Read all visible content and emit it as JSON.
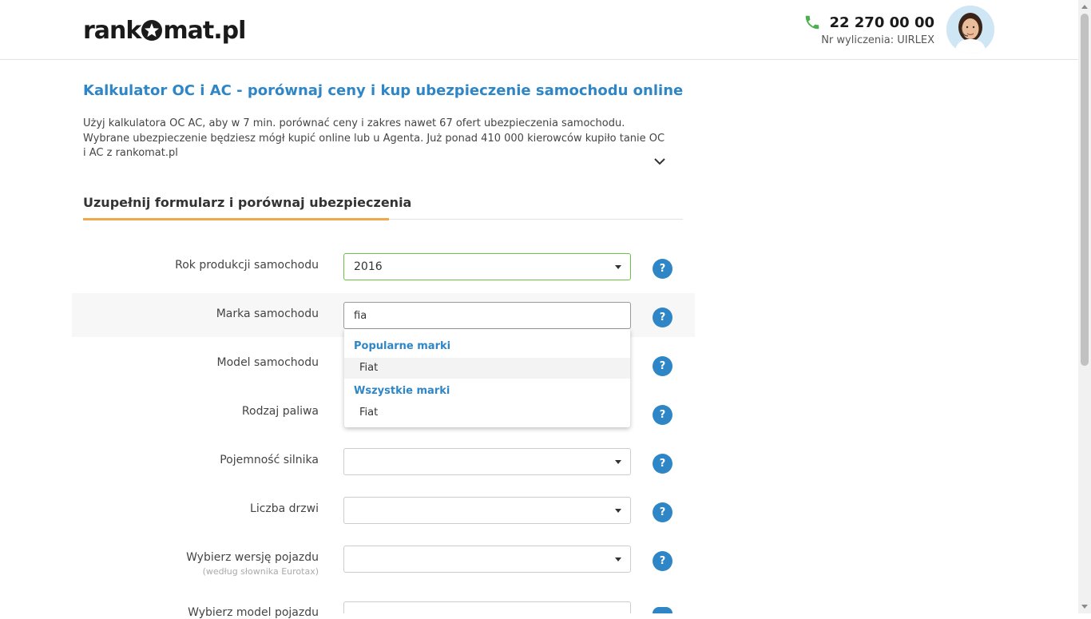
{
  "header": {
    "logo_left": "rank",
    "logo_right": "mat.pl",
    "phone": "22 270 00 00",
    "calc_id": "Nr wyliczenia: UIRLEX"
  },
  "intro": {
    "title": "Kalkulator OC i AC - porównaj ceny i kup ubezpieczenie samochodu online",
    "text": "Użyj kalkulatora OC AC, aby w 7 min. porównać ceny i zakres nawet 67 ofert ubezpieczenia samochodu. Wybrane ubezpieczenie będziesz mógł kupić online lub u Agenta. Już ponad 410 000 kierowców kupiło tanie OC i AC z rankomat.pl"
  },
  "form": {
    "section_title": "Uzupełnij formularz i porównaj ubezpieczenia",
    "fields": {
      "year": {
        "label": "Rok produkcji samochodu",
        "value": "2016"
      },
      "brand": {
        "label": "Marka samochodu",
        "value": "fia"
      },
      "model": {
        "label": "Model samochodu"
      },
      "fuel": {
        "label": "Rodzaj paliwa"
      },
      "engine": {
        "label": "Pojemność silnika",
        "value": ""
      },
      "doors": {
        "label": "Liczba drzwi",
        "value": ""
      },
      "version": {
        "label": "Wybierz wersję pojazdu",
        "sublabel": "(według słownika Eurotax)",
        "value": ""
      },
      "vehicle_model": {
        "label": "Wybierz model pojazdu"
      }
    },
    "help_label": "?"
  },
  "dropdown": {
    "popular_header": "Popularne marki",
    "popular_items": [
      "Fiat"
    ],
    "all_header": "Wszystkie marki",
    "all_items": [
      "Fiat"
    ]
  },
  "colors": {
    "accent": "#2f86c7",
    "underline": "#f0a94a",
    "valid_border": "#6cc04a",
    "phone_icon": "#4caf50"
  }
}
